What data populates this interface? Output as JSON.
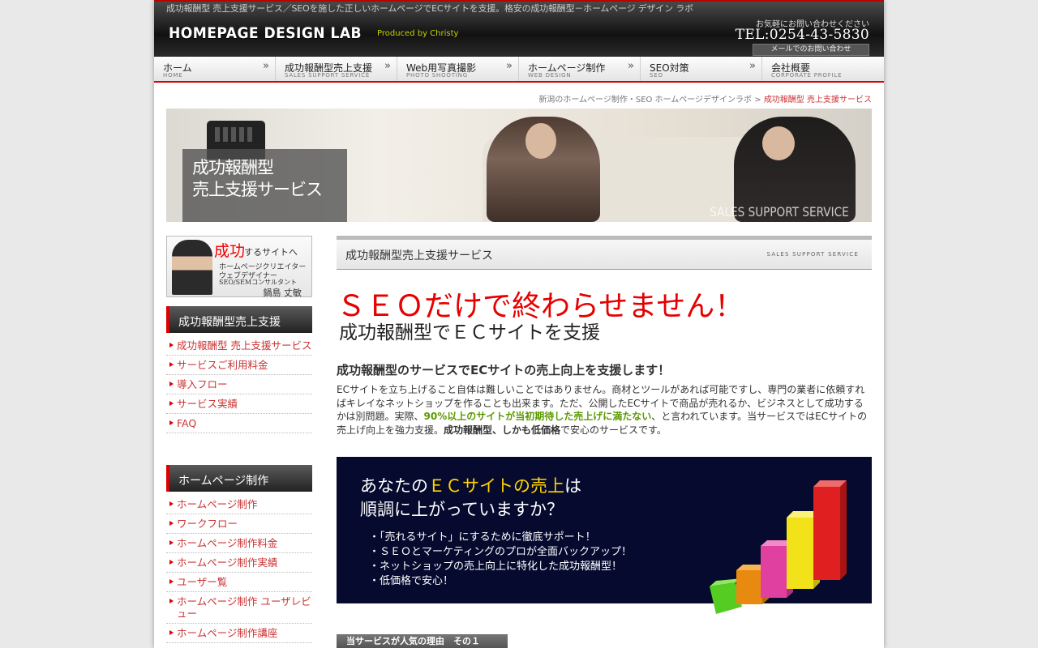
{
  "header": {
    "tagline": "成功報酬型 売上支援サービス／SEOを施した正しいホームページでECサイトを支援。格安の成功報酬型－ホームページ デザイン ラボ",
    "logo": "HOMEPAGE DESIGN LAB",
    "produced_by": "Produced by Christy",
    "contact_label": "お気軽にお問い合わせください",
    "tel": "TEL:0254-43-5830",
    "mail_button": "メールでのお問い合わせ"
  },
  "nav": [
    {
      "label": "ホーム",
      "sub": "HOME"
    },
    {
      "label": "成功報酬型売上支援",
      "sub": "SALES SUPPORT SERVICE"
    },
    {
      "label": "Web用写真撮影",
      "sub": "PHOTO SHOOTING"
    },
    {
      "label": "ホームページ制作",
      "sub": "WEB DESIGN"
    },
    {
      "label": "SEO対策",
      "sub": "SEO"
    },
    {
      "label": "会社概要",
      "sub": "CORPORATE PROFILE"
    }
  ],
  "breadcrumb": {
    "home": "新潟のホームページ制作・SEO ホームページデザインラボ",
    "sep": " > ",
    "current": "成功報酬型 売上支援サービス"
  },
  "hero": {
    "title": "成功報酬型\n売上支援サービス",
    "en": "SALES SUPPORT SERVICE"
  },
  "profile": {
    "big": "成功",
    "rest": "するサイトへ",
    "line1": "ホームページクリエイター",
    "line2": "ウェブデザイナー",
    "line3": "SEO/SEMコンサルタント",
    "name": "鍋島 丈敏"
  },
  "sidebar": {
    "section1": {
      "title": "成功報酬型売上支援",
      "items": [
        "成功報酬型 売上支援サービス",
        "サービスご利用料金",
        "導入フロー",
        "サービス実績",
        "FAQ"
      ]
    },
    "section2": {
      "title": "ホームページ制作",
      "items": [
        "ホームページ制作",
        "ワークフロー",
        "ホームページ制作料金",
        "ホームページ制作実績",
        "ユーザー覧",
        "ホームページ制作 ユーザレビュー",
        "ホームページ制作講座"
      ]
    }
  },
  "main": {
    "heading": "成功報酬型売上支援サービス",
    "heading_en": "SALES SUPPORT SERVICE",
    "catch1": "ＳＥＯだけで終わらせません！",
    "catch2": "成功報酬型でＥＣサイトを支援",
    "lead_title": "成功報酬型のサービスでECサイトの売上向上を支援します！",
    "lead_p1": "ECサイトを立ち上げること自体は難しいことではありません。商材とツールがあれば可能ですし、専門の業者に依頼すればキレイなネットショップを作ることも出来ます。ただ、公開したECサイトで商品が売れるか、ビジネスとして成功するかは別問題。実際、",
    "lead_green": "90%以上のサイトが当初期待した売上げに満たない",
    "lead_p2": "、と言われています。当サービスではECサイトの売上げ向上を強力支援。",
    "lead_bold": "成功報酬型、しかも低価格",
    "lead_p3": "で安心のサービスです。"
  },
  "banner": {
    "q1_pre": "あなたの",
    "q1_hl": "ＥＣサイトの売上",
    "q1_post": "は",
    "q2": "順調に上がっていますか？",
    "bullets": [
      "・「売れるサイト」にするために徹底サポート！",
      "・ＳＥＯとマーケティングのプロが全面バックアップ！",
      "・ネットショップの売上向上に特化した成功報酬型！",
      "・低価格で安心！"
    ],
    "bar_colors": [
      "#55cc22",
      "#e88a10",
      "#e040a0",
      "#f2e21a",
      "#e02020"
    ]
  },
  "reason_tab": "当サービスが人気の理由　その１",
  "colors": {
    "accent_red": "#dd0000",
    "link_red": "#cc3333",
    "highlight_green": "#5a9a00",
    "banner_bg": "#050a2e"
  }
}
